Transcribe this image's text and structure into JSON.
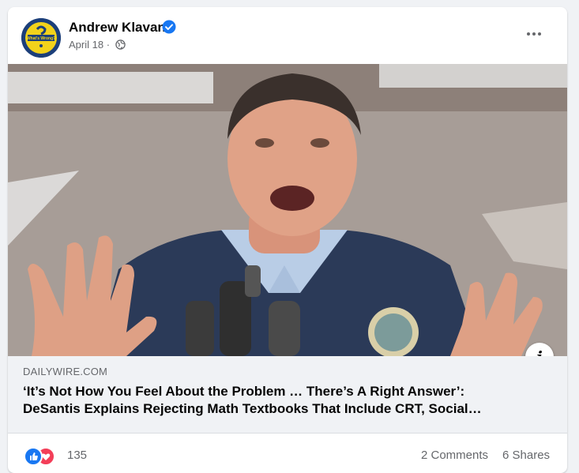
{
  "post": {
    "author": "Andrew Klavan",
    "date": "April 18",
    "separator": "·",
    "avatar_text": "What's Wrong?"
  },
  "link": {
    "domain": "DAILYWIRE.COM",
    "headline_line1": "‘It’s Not How You Feel About the Problem … There’s A Right Answer’:",
    "headline_line2": "DeSantis Explains Rejecting Math Textbooks That Include CRT, Social…"
  },
  "stats": {
    "reaction_count": "135",
    "comments": "2 Comments",
    "shares": "6 Shares"
  },
  "colors": {
    "verified": "#1877f2",
    "like": "#1877f2",
    "love": "#f33e58",
    "jacket": "#2b3a58"
  },
  "icons": [
    "verified-badge-icon",
    "globe-icon",
    "more-options-icon",
    "info-icon",
    "like-reaction-icon",
    "love-reaction-icon"
  ]
}
